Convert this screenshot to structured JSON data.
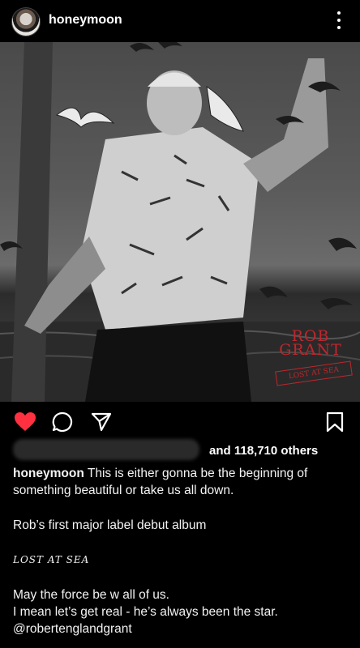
{
  "post": {
    "username": "honeymoon",
    "more_icon": "more-vertical-icon",
    "photo": {
      "artist_line1": "ROB",
      "artist_line2": "GRANT",
      "album_subtitle": "LOST AT SEA"
    },
    "actions": {
      "like_icon": "heart-filled-icon",
      "comment_icon": "comment-icon",
      "share_icon": "send-icon",
      "save_icon": "bookmark-icon",
      "like_color": "#ff3040"
    },
    "likes": {
      "text": "and 118,710 others"
    },
    "caption": {
      "username": "honeymoon",
      "line1": "This is either gonna be the beginning of something beautiful or take us all down.",
      "line2": "Rob’s first major label debut album",
      "line3": "LOST AT SEA",
      "line4": "May the force be w all of us.",
      "line5": "I mean let’s get real - he’s always been the star.",
      "line6": "@robertenglandgrant"
    }
  }
}
